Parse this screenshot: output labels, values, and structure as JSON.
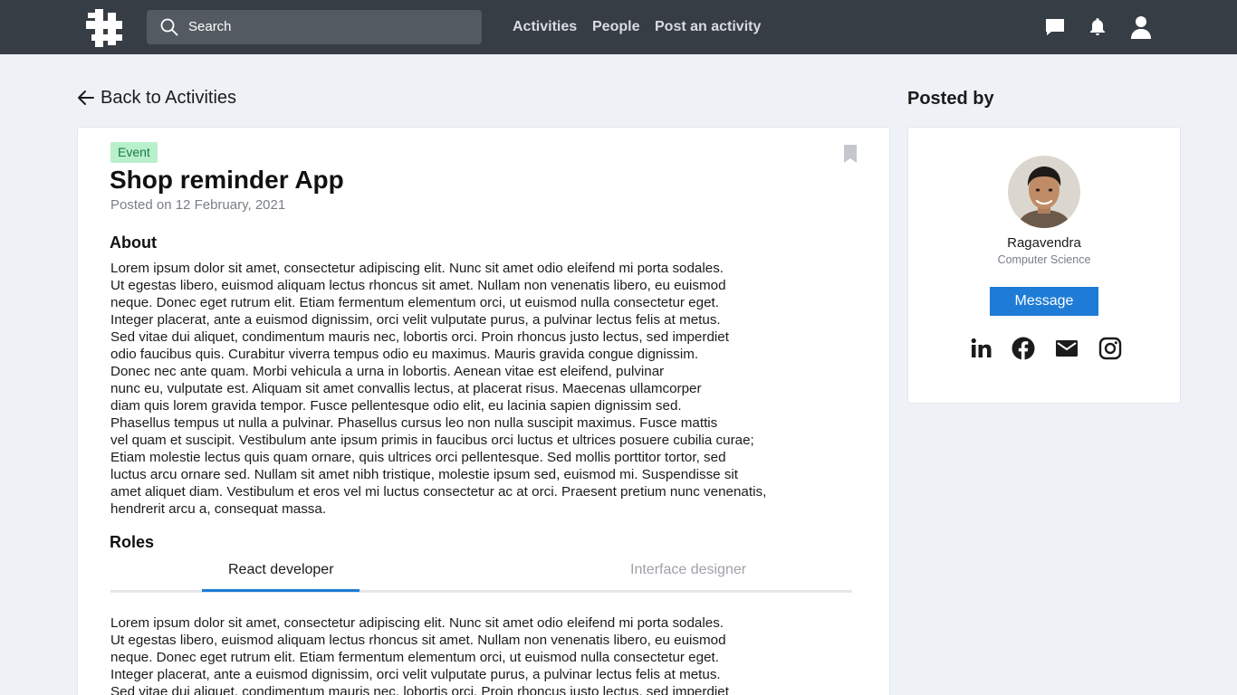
{
  "navbar": {
    "logo": "app-logo",
    "search_placeholder": "Search",
    "links": [
      "Activities",
      "People",
      "Post an activity"
    ],
    "icons": [
      "chat-icon",
      "bell-icon",
      "user-icon"
    ]
  },
  "back_label": "Back to Activities",
  "activity": {
    "badge": "Event",
    "title": "Shop reminder App",
    "posted": "Posted on 12 February, 2021",
    "about_heading": "About",
    "about_text": "Lorem ipsum dolor sit amet, consectetur adipiscing elit. Nunc sit amet odio eleifend mi porta sodales.\nUt egestas libero, euismod aliquam lectus rhoncus sit amet. Nullam non venenatis libero, eu euismod\nneque. Donec eget rutrum elit. Etiam fermentum elementum orci, ut euismod nulla consectetur eget.\nInteger placerat, ante a euismod dignissim, orci velit vulputate purus, a pulvinar lectus felis at metus.\nSed vitae dui aliquet, condimentum mauris nec, lobortis orci. Proin rhoncus justo lectus, sed imperdiet\nodio faucibus quis. Curabitur viverra tempus odio eu maximus. Mauris gravida congue dignissim.\nDonec nec ante quam. Morbi vehicula a urna in lobortis. Aenean vitae est eleifend, pulvinar\nnunc eu, vulputate est. Aliquam sit amet convallis lectus, at placerat risus. Maecenas ullamcorper\ndiam quis lorem gravida tempor. Fusce pellentesque odio elit, eu lacinia sapien dignissim sed.\nPhasellus tempus ut nulla a pulvinar. Phasellus cursus leo non nulla suscipit maximus. Fusce mattis\nvel quam et suscipit. Vestibulum ante ipsum primis in faucibus orci luctus et ultrices posuere cubilia curae;\nEtiam molestie lectus quis quam ornare, quis ultrices orci pellentesque. Sed mollis porttitor tortor, sed\nluctus arcu ornare sed. Nullam sit amet nibh tristique, molestie ipsum sed, euismod mi. Suspendisse sit\namet aliquet diam. Vestibulum et eros vel mi luctus consectetur ac at orci. Praesent pretium nunc venenatis,\nhendrerit arcu a, consequat massa.",
    "roles_heading": "Roles",
    "tabs": [
      "React developer",
      "Interface designer"
    ],
    "role_text": "Lorem ipsum dolor sit amet, consectetur adipiscing elit. Nunc sit amet odio eleifend mi porta sodales.\nUt egestas libero, euismod aliquam lectus rhoncus sit amet. Nullam non venenatis libero, eu euismod\nneque. Donec eget rutrum elit. Etiam fermentum elementum orci, ut euismod nulla consectetur eget.\nInteger placerat, ante a euismod dignissim, orci velit vulputate purus, a pulvinar lectus felis at metus.\nSed vitae dui aliquet, condimentum mauris nec, lobortis orci. Proin rhoncus justo lectus, sed imperdiet"
  },
  "poster": {
    "heading": "Posted by",
    "name": "Ragavendra",
    "department": "Computer Science",
    "message_label": "Message",
    "socials": [
      "linkedin-icon",
      "facebook-icon",
      "email-icon",
      "instagram-icon"
    ]
  },
  "colors": {
    "navbar": "#373d45",
    "accent": "#1e7cd6",
    "badge_bg": "#b8f0cc",
    "badge_text": "#1c7a3f",
    "page_bg": "#eef2f7"
  }
}
